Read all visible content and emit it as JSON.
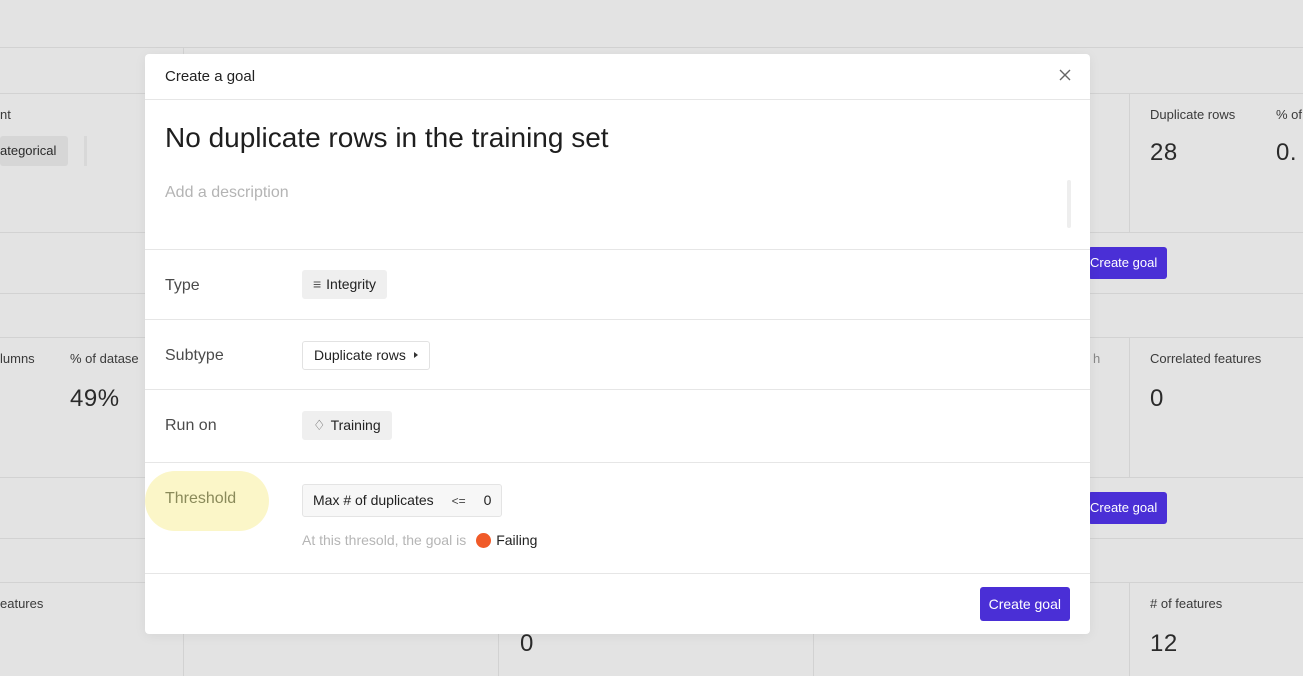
{
  "background": {
    "left_labels": {
      "col1": "nt",
      "chip1": "ategorical",
      "col2": "lumns",
      "col3": "% of datase",
      "value1": "49%",
      "col4": "eatures"
    },
    "right_labels": {
      "dup_rows": "Duplicate rows",
      "pct": "% of",
      "dup_value": "28",
      "pct_value": "0.",
      "create1": "Create goal",
      "h": "h",
      "corr": "Correlated features",
      "corr_value": "0",
      "create2": "Create goal",
      "nfeat": "# of features",
      "nfeat_value": "12"
    },
    "center_value": "0"
  },
  "modal": {
    "title": "Create a goal",
    "goal_title": "No duplicate rows in the training set",
    "description_placeholder": "Add a description",
    "type": {
      "label": "Type",
      "value": "Integrity"
    },
    "subtype": {
      "label": "Subtype",
      "value": "Duplicate rows"
    },
    "run_on": {
      "label": "Run on",
      "value": "Training"
    },
    "threshold": {
      "label": "Threshold",
      "metric": "Max # of duplicates",
      "operator": "<=",
      "value": "0",
      "status_prefix": "At this thresold, the goal is",
      "status": "Failing",
      "status_color": "#f05a28"
    },
    "create_button": "Create goal",
    "accent_color": "#4a2fd6"
  }
}
